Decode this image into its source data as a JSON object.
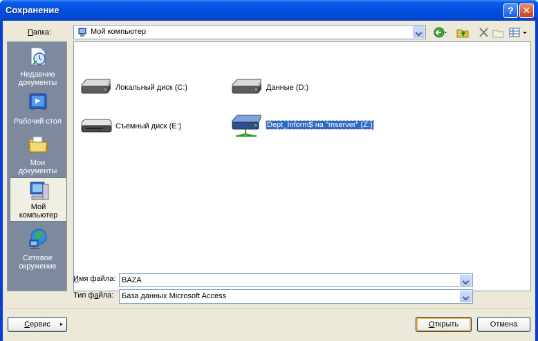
{
  "window": {
    "title": "Сохранение"
  },
  "titlebar": {
    "help_label": "?",
    "close_label": "✕"
  },
  "lookin": {
    "label_prefix": "",
    "label_key": "П",
    "label_rest": "апка:",
    "value": "Мой компьютер"
  },
  "toolbar": {
    "back_icon": "back-arrow-icon",
    "up_icon": "folder-up-icon",
    "delete_icon": "delete-icon",
    "newfolder_icon": "new-folder-icon",
    "views_icon": "views-menu-icon"
  },
  "places": [
    {
      "label_line1": "Недавние",
      "label_line2": "документы",
      "icon": "recent-documents-icon"
    },
    {
      "label_line1": "Рабочий стол",
      "label_line2": "",
      "icon": "desktop-icon"
    },
    {
      "label_line1": "Мои",
      "label_line2": "документы",
      "icon": "my-documents-icon"
    },
    {
      "label_line1": "Мой",
      "label_line2": "компьютер",
      "icon": "my-computer-icon"
    },
    {
      "label_line1": "Сетевое",
      "label_line2": "окружение",
      "icon": "network-places-icon"
    }
  ],
  "files": [
    {
      "name": "Локальный диск (C:)",
      "icon": "hard-drive-icon"
    },
    {
      "name": "Данные (D:)",
      "icon": "hard-drive-icon"
    },
    {
      "name": "Съемный диск (E:)",
      "icon": "removable-drive-icon"
    },
    {
      "name": "Dept_Inform$ на \"mserver\" (Z:)",
      "icon": "network-drive-icon"
    }
  ],
  "filename": {
    "label_key": "И",
    "label_rest": "мя файла:",
    "value": "BAZA"
  },
  "filetype": {
    "label_pre": "Тип ф",
    "label_key": "а",
    "label_rest": "йла:",
    "value": "База данных Microsoft Access"
  },
  "buttons": {
    "service_pre": "",
    "service_key": "С",
    "service_rest": "ервис",
    "open_pre": "",
    "open_key": "О",
    "open_rest": "ткрыть",
    "cancel": "Отмена"
  },
  "colors": {
    "titlebar": "#0350e0",
    "selection": "#316ac5",
    "places_bg": "#7d8a9e",
    "dialog_bg": "#ece9d8"
  }
}
